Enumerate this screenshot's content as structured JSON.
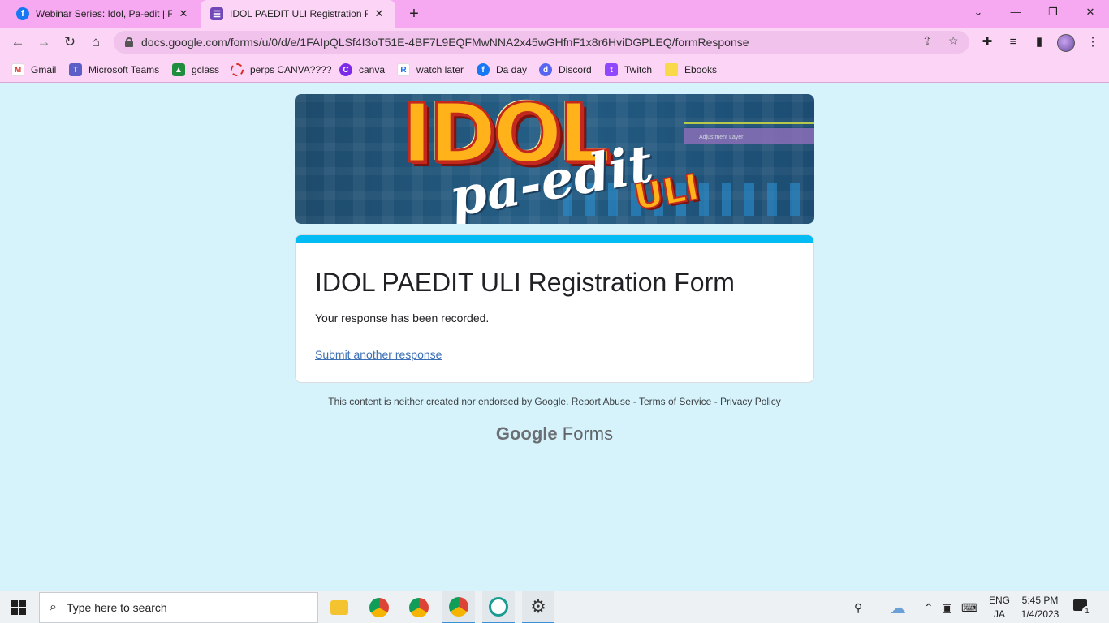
{
  "browser": {
    "tabs": [
      {
        "title": "Webinar Series: Idol, Pa-edit | Facebook",
        "favicon": "facebook-icon",
        "active": false
      },
      {
        "title": "IDOL PAEDIT ULI Registration Form",
        "favicon": "google-forms-icon",
        "active": true
      }
    ],
    "new_tab": "+",
    "url": "docs.google.com/forms/u/0/d/e/1FAIpQLSf4I3oT51E-4BF7L9EQFMwNNA2x45wGHfnF1x8r6HviDGPLEQ/formResponse",
    "bookmarks": [
      {
        "label": "Gmail",
        "icon": "gmail-icon"
      },
      {
        "label": "Microsoft Teams",
        "icon": "teams-icon"
      },
      {
        "label": "gclass",
        "icon": "classroom-icon"
      },
      {
        "label": "perps CANVA????",
        "icon": "canva-ring-icon"
      },
      {
        "label": "canva",
        "icon": "canva-icon"
      },
      {
        "label": "watch later",
        "icon": "r-icon"
      },
      {
        "label": "Da day",
        "icon": "facebook-icon"
      },
      {
        "label": "Discord",
        "icon": "discord-icon"
      },
      {
        "label": "Twitch",
        "icon": "twitch-icon"
      },
      {
        "label": "Ebooks",
        "icon": "folder-icon"
      }
    ]
  },
  "banner": {
    "word1": "IDOL",
    "word2": "pa-edit",
    "word3": "ULI",
    "track_label": "Adjustment Layer"
  },
  "form": {
    "title": "IDOL PAEDIT ULI Registration Form",
    "message": "Your response has been recorded.",
    "submit_another": "Submit another response",
    "accent": "#03bcf4"
  },
  "footer": {
    "disclaimer": "This content is neither created nor endorsed by Google.",
    "report_abuse": "Report Abuse",
    "terms": "Terms of Service",
    "privacy": "Privacy Policy",
    "sep": "-",
    "brand_google": "Google",
    "brand_forms": "Forms"
  },
  "taskbar": {
    "search_placeholder": "Type here to search",
    "lang_line1": "ENG",
    "lang_line2": "JA",
    "time": "5:45 PM",
    "date": "1/4/2023",
    "notification_count": "1"
  }
}
